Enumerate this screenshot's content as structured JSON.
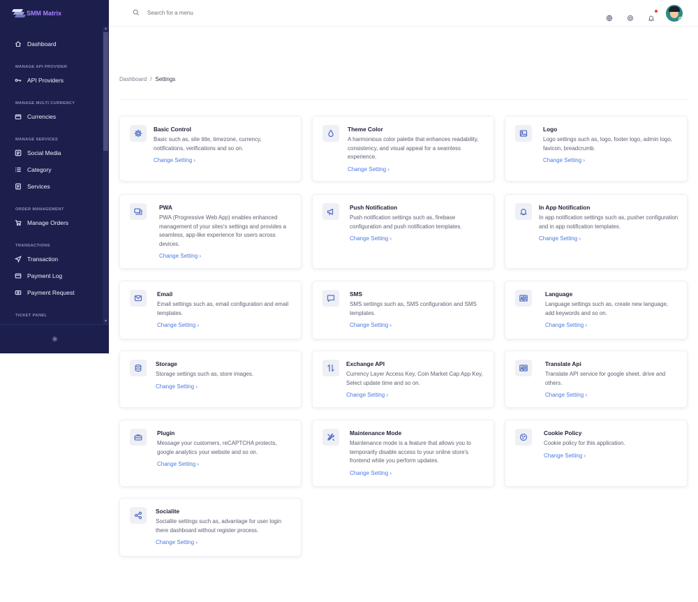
{
  "brand": {
    "name": "SMM Matrix"
  },
  "search": {
    "placeholder": "Search for a menu"
  },
  "sidebar": {
    "dashboard": "Dashboard",
    "sections": [
      {
        "label": "MANAGE API PROVIDER",
        "items": [
          "API Providers"
        ]
      },
      {
        "label": "MANAGE MULTI CURRENCY",
        "items": [
          "Currencies"
        ]
      },
      {
        "label": "MANAGE SERVICES",
        "items": [
          "Social Media",
          "Category",
          "Services"
        ]
      },
      {
        "label": "ORDER MANAGEMENT",
        "items": [
          "Manage Orders"
        ]
      },
      {
        "label": "TRANSACTIONS",
        "items": [
          "Transaction",
          "Payment Log",
          "Payment Request"
        ]
      },
      {
        "label": "TICKET PANEL",
        "items": []
      }
    ]
  },
  "breadcrumb": {
    "home": "Dashboard",
    "separator": "/",
    "current": "Settings"
  },
  "link_label": "Change Setting ›",
  "cards": [
    {
      "title": "Basic Control",
      "icon": "gear-icon",
      "desc": "Basic such as, site title, timezone, currency, notifications, verifications and so on."
    },
    {
      "title": "Theme Color",
      "icon": "droplet-icon",
      "desc": "A harmonious color palette that enhances readability, consistency, and visual appeal for a seamless experience."
    },
    {
      "title": "Logo",
      "icon": "image-icon",
      "desc": "Logo settings such as, logo, footer logo, admin logo, favicon, breadcrumb."
    },
    {
      "title": "PWA",
      "icon": "devices-icon",
      "desc": "PWA (Progressive Web App) enables enhanced management of your sites's settings and provides a seamless, app-like experience for users across devices."
    },
    {
      "title": "Push Notification",
      "icon": "megaphone-icon",
      "desc": "Push notification settings such as, firebase configuration and push notification templates."
    },
    {
      "title": "In App Notification",
      "icon": "bell-icon",
      "desc": "In app notification settings such as, pusher configuration and in app notification templates."
    },
    {
      "title": "Email",
      "icon": "mail-icon",
      "desc": "Email settings such as, email configuration and email templates."
    },
    {
      "title": "SMS",
      "icon": "chat-icon",
      "desc": "SMS settings such as, SMS configuration and SMS templates."
    },
    {
      "title": "Language",
      "icon": "translate-icon",
      "desc": "Language settings such as, create new language, add keywords and so on."
    },
    {
      "title": "Storage",
      "icon": "database-icon",
      "desc": "Storage settings such as, store images."
    },
    {
      "title": "Exchange API",
      "icon": "exchange-icon",
      "desc": "Currency Layer Access Key, Coin Market Cap App Key, Select update time and so on."
    },
    {
      "title": "Translate Api",
      "icon": "translate-icon",
      "desc": "Translate API service for google sheet, drive and others."
    },
    {
      "title": "Plugin",
      "icon": "toolbox-icon",
      "desc": "Message your customers, reCAPTCHA protects, google analytics your website and so on."
    },
    {
      "title": "Maintenance Mode",
      "icon": "tools-icon",
      "desc": "Maintenance mode is a feature that allows you to temporarily disable access to your online store's frontend while you perform updates."
    },
    {
      "title": "Cookie Policy",
      "icon": "cookie-icon",
      "desc": "Cookie policy for this application."
    },
    {
      "title": "Socialite",
      "icon": "share-icon",
      "desc": "Socialite settings such as, advantage for user login there dashboard without register process."
    }
  ]
}
